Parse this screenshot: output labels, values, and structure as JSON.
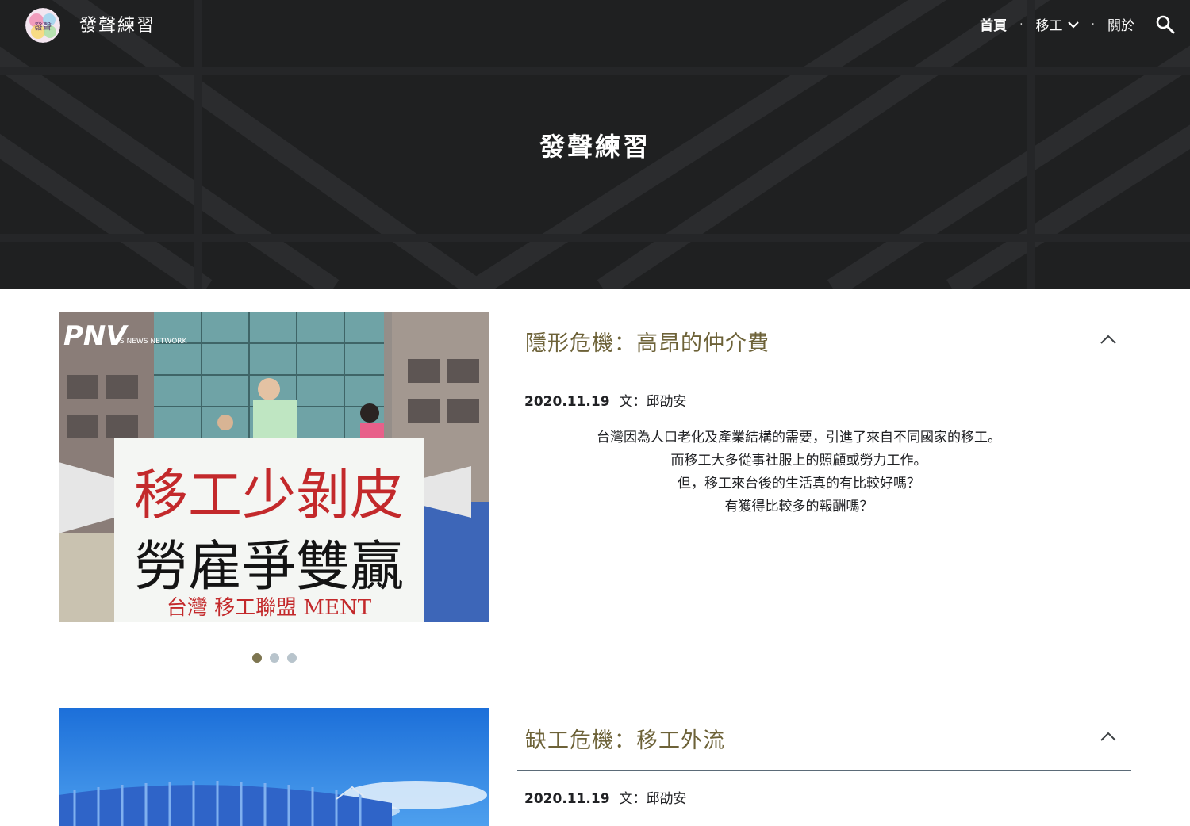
{
  "header": {
    "site_title": "發聲練習",
    "nav": [
      {
        "label": "首頁",
        "active": true
      },
      {
        "label": "移工",
        "has_dropdown": true
      },
      {
        "label": "關於"
      }
    ],
    "nav_separator": "·",
    "hero_title": "發聲練習",
    "search_icon": "search-icon"
  },
  "sections": [
    {
      "image": {
        "description_icon": "protest-photo",
        "banner_line1": "移工少剝皮",
        "banner_line2": "勞雇爭雙贏",
        "banner_footer": "台灣 移工聯盟 MENT",
        "watermark": "PTS NEWS NETWORK"
      },
      "title": "隱形危機：高昂的仲介費",
      "date": "2020.11.19",
      "author": "文：邱劭安",
      "paragraph": [
        "台灣因為人口老化及產業結構的需要，引進了來自不同國家的移工。",
        "而移工大多從事社服上的照顧或勞力工作。",
        "但，移工來台後的生活真的有比較好嗎？",
        "有獲得比較多的報酬嗎？"
      ],
      "carousel_dots": 3,
      "carousel_active": 0
    },
    {
      "title": "缺工危機：移工外流",
      "date": "2020.11.19",
      "author": "文：邱劭安"
    }
  ],
  "colors": {
    "accent_title": "#6d6238",
    "dot_active": "#7d7550",
    "dot_inactive": "#b8c4cc",
    "hero_bg": "#2b2c2e"
  }
}
